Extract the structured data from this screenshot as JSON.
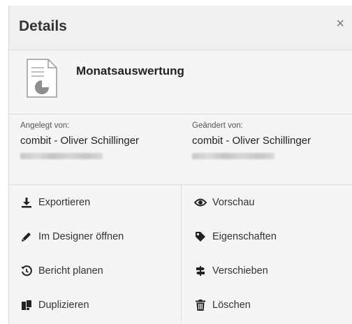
{
  "header": {
    "title": "Details",
    "close_label": "×"
  },
  "document": {
    "name": "Monatsauswertung",
    "icon": "report-document-icon"
  },
  "created": {
    "label": "Angelegt von:",
    "user": "combit - Oliver Schillinger"
  },
  "modified": {
    "label": "Geändert von:",
    "user": "combit - Oliver Schillinger"
  },
  "actions": [
    {
      "label": "Exportieren",
      "icon": "download-icon"
    },
    {
      "label": "Vorschau",
      "icon": "eye-icon"
    },
    {
      "label": "Im Designer öffnen",
      "icon": "pencil-icon"
    },
    {
      "label": "Eigenschaften",
      "icon": "tag-icon"
    },
    {
      "label": "Bericht planen",
      "icon": "history-icon"
    },
    {
      "label": "Verschieben",
      "icon": "signpost-icon"
    },
    {
      "label": "Duplizieren",
      "icon": "copy-icon"
    },
    {
      "label": "Löschen",
      "icon": "trash-icon"
    }
  ],
  "colors": {
    "icon": "#222222",
    "border": "#dcdcdc",
    "panel_bg": "#f5f5f5"
  }
}
